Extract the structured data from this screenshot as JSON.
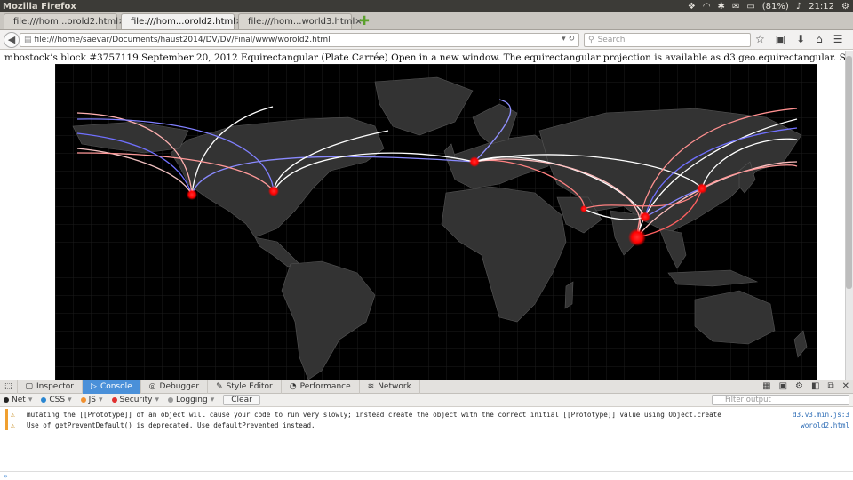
{
  "window": {
    "title": "Mozilla Firefox"
  },
  "tray": {
    "battery": "(81%)",
    "time": "21:12"
  },
  "tabs": [
    {
      "label": "file:///hom...orold2.html",
      "active": false
    },
    {
      "label": "file:///hom...orold2.html",
      "active": true
    },
    {
      "label": "file:///hom...world3.html",
      "active": false
    }
  ],
  "navbar": {
    "url": "file:///home/saevar/Documents/haust2014/DV/DV/Final/www/worold2.html",
    "search_placeholder": "Search"
  },
  "page": {
    "headline": "mbostock’s block #3757119 September 20, 2012 Equirectangular (Plate Carrée) Open in a new window. The equirectangular projection is available as d3.geo.equirectangular. See also the rotating version."
  },
  "devtools": {
    "tabs": [
      "Inspector",
      "Console",
      "Debugger",
      "Style Editor",
      "Performance",
      "Network"
    ],
    "active_tab": "Console",
    "filters": {
      "net": "Net",
      "css": "CSS",
      "js": "JS",
      "security": "Security",
      "logging": "Logging",
      "clear": "Clear"
    },
    "filter_placeholder": "Filter output",
    "messages": [
      {
        "text": "mutating the [[Prototype]] of an object will cause your code to run very slowly; instead create the object with the correct initial [[Prototype]] value using Object.create",
        "source": "d3.v3.min.js:3"
      },
      {
        "text": "Use of getPreventDefault() is deprecated.  Use defaultPrevented instead.",
        "source": "worold2.html"
      }
    ],
    "prompt": "»"
  },
  "colors": {
    "accent": "#4a90d9",
    "map_bg": "#000000",
    "land": "#333333",
    "hub": "#ff1a1a"
  }
}
